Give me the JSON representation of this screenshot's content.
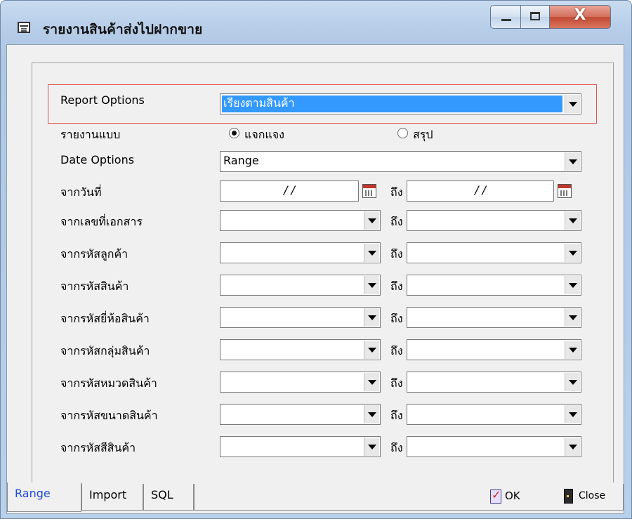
{
  "window": {
    "title": "รายงานสินค้าส่งไปฝากขาย",
    "close_glyph": "X"
  },
  "form": {
    "report_options": {
      "label": "Report Options",
      "value": "เรียงตามสินค้า"
    },
    "report_type": {
      "label": "รายงานแบบ",
      "options": [
        "แจกแจง",
        "สรุป"
      ],
      "selected": "แจกแจง"
    },
    "date_options": {
      "label": "Date Options",
      "value": "Range"
    },
    "date_from": {
      "label": "จากวันที่",
      "from_value": "/ /",
      "to_label": "ถึง",
      "to_value": "/ /"
    },
    "ranges": [
      {
        "label": "จากเลขที่เอกสาร",
        "to_label": "ถึง"
      },
      {
        "label": "จากรหัสลูกค้า",
        "to_label": "ถึง"
      },
      {
        "label": "จากรหัสสินค้า",
        "to_label": "ถึง"
      },
      {
        "label": "จากรหัสยี่ห้อสินค้า",
        "to_label": "ถึง"
      },
      {
        "label": "จากรหัสกลุ่มสินค้า",
        "to_label": "ถึง"
      },
      {
        "label": "จากรหัสหมวดสินค้า",
        "to_label": "ถึง"
      },
      {
        "label": "จากรหัสขนาดสินค้า",
        "to_label": "ถึง"
      },
      {
        "label": "จากรหัสสีสินค้า",
        "to_label": "ถึง"
      }
    ]
  },
  "tabs": [
    "Range",
    "Import",
    "SQL"
  ],
  "active_tab": "Range",
  "actions": {
    "ok": "OK",
    "close": "Close"
  },
  "colors": {
    "tab_active_text": "#1e4bd8",
    "highlight_border": "#e05555",
    "selection": "#3399ff"
  }
}
